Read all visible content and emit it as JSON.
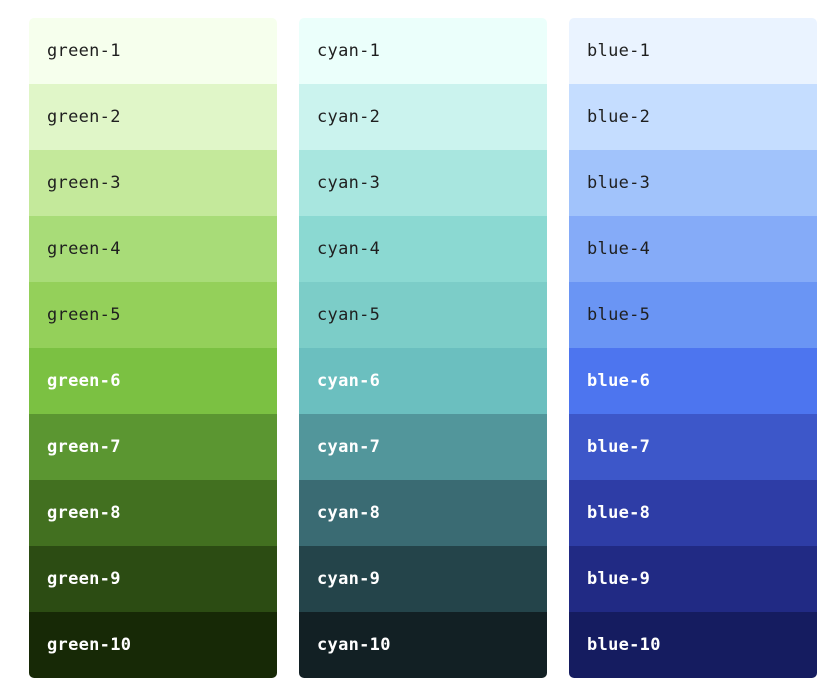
{
  "palettes": [
    {
      "name": "green",
      "swatches": [
        {
          "label": "green-1",
          "color": "#f6ffed",
          "text": "dark"
        },
        {
          "label": "green-2",
          "color": "#e0f6c8",
          "text": "dark"
        },
        {
          "label": "green-3",
          "color": "#c4e99b",
          "text": "dark"
        },
        {
          "label": "green-4",
          "color": "#a8dc78",
          "text": "dark"
        },
        {
          "label": "green-5",
          "color": "#94d05a",
          "text": "dark"
        },
        {
          "label": "green-6",
          "color": "#7bc142",
          "text": "light"
        },
        {
          "label": "green-7",
          "color": "#5b9631",
          "text": "light"
        },
        {
          "label": "green-8",
          "color": "#427020",
          "text": "light"
        },
        {
          "label": "green-9",
          "color": "#2c4c13",
          "text": "light"
        },
        {
          "label": "green-10",
          "color": "#172906",
          "text": "light"
        }
      ]
    },
    {
      "name": "cyan",
      "swatches": [
        {
          "label": "cyan-1",
          "color": "#ebfffb",
          "text": "dark"
        },
        {
          "label": "cyan-2",
          "color": "#cbf3ee",
          "text": "dark"
        },
        {
          "label": "cyan-3",
          "color": "#a8e6df",
          "text": "dark"
        },
        {
          "label": "cyan-4",
          "color": "#8bd9d2",
          "text": "dark"
        },
        {
          "label": "cyan-5",
          "color": "#7ccdc8",
          "text": "dark"
        },
        {
          "label": "cyan-6",
          "color": "#6bbfbf",
          "text": "light"
        },
        {
          "label": "cyan-7",
          "color": "#52969b",
          "text": "light"
        },
        {
          "label": "cyan-8",
          "color": "#3a6b73",
          "text": "light"
        },
        {
          "label": "cyan-9",
          "color": "#24444a",
          "text": "light"
        },
        {
          "label": "cyan-10",
          "color": "#122024",
          "text": "light"
        }
      ]
    },
    {
      "name": "blue",
      "swatches": [
        {
          "label": "blue-1",
          "color": "#eaf3ff",
          "text": "dark"
        },
        {
          "label": "blue-2",
          "color": "#c5ddff",
          "text": "dark"
        },
        {
          "label": "blue-3",
          "color": "#a1c3fb",
          "text": "dark"
        },
        {
          "label": "blue-4",
          "color": "#85abf8",
          "text": "dark"
        },
        {
          "label": "blue-5",
          "color": "#6a95f4",
          "text": "dark"
        },
        {
          "label": "blue-6",
          "color": "#4d75ef",
          "text": "light"
        },
        {
          "label": "blue-7",
          "color": "#3d57c9",
          "text": "light"
        },
        {
          "label": "blue-8",
          "color": "#2e3da6",
          "text": "light"
        },
        {
          "label": "blue-9",
          "color": "#212a84",
          "text": "light"
        },
        {
          "label": "blue-10",
          "color": "#151c60",
          "text": "light"
        }
      ]
    }
  ]
}
